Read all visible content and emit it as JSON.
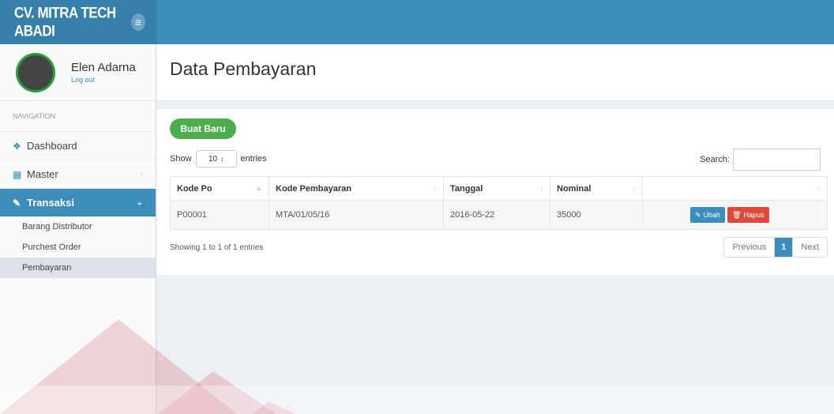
{
  "header": {
    "brand": "CV. MITRA TECH ABADI",
    "menu_icon": "≡"
  },
  "user": {
    "name": "Elen Adarna",
    "logout": "Log out"
  },
  "nav": {
    "header": "NAVIGATION",
    "items": [
      {
        "label": "Dashboard",
        "icon": "home-icon"
      },
      {
        "label": "Master",
        "icon": "bar-chart-icon"
      },
      {
        "label": "Transaksi",
        "icon": "edit-icon"
      }
    ],
    "sub_items": [
      {
        "label": "Barang Distributor"
      },
      {
        "label": "Purchest Order"
      },
      {
        "label": "Pembayaran"
      }
    ]
  },
  "page": {
    "title": "Data Pembayaran"
  },
  "toolbar": {
    "new_button": "Buat Baru",
    "show_label": "Show",
    "entries_value": "10",
    "entries_label": "entries",
    "search_label": "Search:"
  },
  "table": {
    "columns": [
      "Kode Po",
      "Kode Pembayaran",
      "Tanggal",
      "Nominal",
      ""
    ],
    "rows": [
      {
        "kode_po": "P00001",
        "kode_pembayaran": "MTA/01/05/16",
        "tanggal": "2016-05-22",
        "nominal": "35000",
        "edit": "Ubah",
        "delete": "Hapus"
      }
    ]
  },
  "footer": {
    "info": "Showing 1 to 1 of 1 entries",
    "prev": "Previous",
    "page": "1",
    "next": "Next"
  },
  "colors": {
    "primary": "#3c8dbc",
    "success": "#4cae4c",
    "danger": "#dd4b39"
  }
}
